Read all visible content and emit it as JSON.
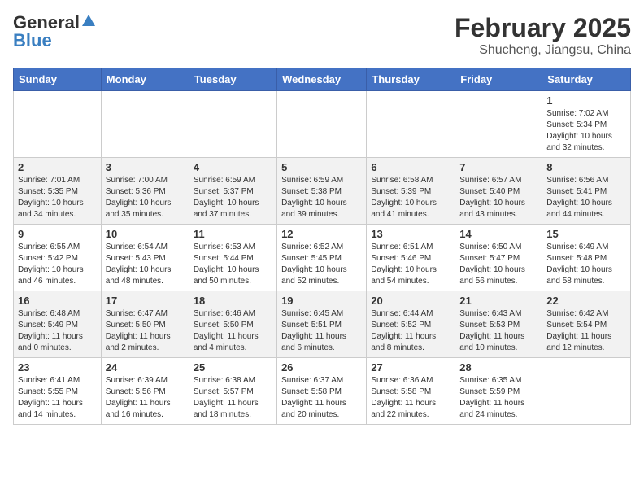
{
  "logo": {
    "general": "General",
    "blue": "Blue"
  },
  "title": {
    "month": "February 2025",
    "location": "Shucheng, Jiangsu, China"
  },
  "weekdays": [
    "Sunday",
    "Monday",
    "Tuesday",
    "Wednesday",
    "Thursday",
    "Friday",
    "Saturday"
  ],
  "weeks": [
    [
      {
        "day": "",
        "info": ""
      },
      {
        "day": "",
        "info": ""
      },
      {
        "day": "",
        "info": ""
      },
      {
        "day": "",
        "info": ""
      },
      {
        "day": "",
        "info": ""
      },
      {
        "day": "",
        "info": ""
      },
      {
        "day": "1",
        "info": "Sunrise: 7:02 AM\nSunset: 5:34 PM\nDaylight: 10 hours and 32 minutes."
      }
    ],
    [
      {
        "day": "2",
        "info": "Sunrise: 7:01 AM\nSunset: 5:35 PM\nDaylight: 10 hours and 34 minutes."
      },
      {
        "day": "3",
        "info": "Sunrise: 7:00 AM\nSunset: 5:36 PM\nDaylight: 10 hours and 35 minutes."
      },
      {
        "day": "4",
        "info": "Sunrise: 6:59 AM\nSunset: 5:37 PM\nDaylight: 10 hours and 37 minutes."
      },
      {
        "day": "5",
        "info": "Sunrise: 6:59 AM\nSunset: 5:38 PM\nDaylight: 10 hours and 39 minutes."
      },
      {
        "day": "6",
        "info": "Sunrise: 6:58 AM\nSunset: 5:39 PM\nDaylight: 10 hours and 41 minutes."
      },
      {
        "day": "7",
        "info": "Sunrise: 6:57 AM\nSunset: 5:40 PM\nDaylight: 10 hours and 43 minutes."
      },
      {
        "day": "8",
        "info": "Sunrise: 6:56 AM\nSunset: 5:41 PM\nDaylight: 10 hours and 44 minutes."
      }
    ],
    [
      {
        "day": "9",
        "info": "Sunrise: 6:55 AM\nSunset: 5:42 PM\nDaylight: 10 hours and 46 minutes."
      },
      {
        "day": "10",
        "info": "Sunrise: 6:54 AM\nSunset: 5:43 PM\nDaylight: 10 hours and 48 minutes."
      },
      {
        "day": "11",
        "info": "Sunrise: 6:53 AM\nSunset: 5:44 PM\nDaylight: 10 hours and 50 minutes."
      },
      {
        "day": "12",
        "info": "Sunrise: 6:52 AM\nSunset: 5:45 PM\nDaylight: 10 hours and 52 minutes."
      },
      {
        "day": "13",
        "info": "Sunrise: 6:51 AM\nSunset: 5:46 PM\nDaylight: 10 hours and 54 minutes."
      },
      {
        "day": "14",
        "info": "Sunrise: 6:50 AM\nSunset: 5:47 PM\nDaylight: 10 hours and 56 minutes."
      },
      {
        "day": "15",
        "info": "Sunrise: 6:49 AM\nSunset: 5:48 PM\nDaylight: 10 hours and 58 minutes."
      }
    ],
    [
      {
        "day": "16",
        "info": "Sunrise: 6:48 AM\nSunset: 5:49 PM\nDaylight: 11 hours and 0 minutes."
      },
      {
        "day": "17",
        "info": "Sunrise: 6:47 AM\nSunset: 5:50 PM\nDaylight: 11 hours and 2 minutes."
      },
      {
        "day": "18",
        "info": "Sunrise: 6:46 AM\nSunset: 5:50 PM\nDaylight: 11 hours and 4 minutes."
      },
      {
        "day": "19",
        "info": "Sunrise: 6:45 AM\nSunset: 5:51 PM\nDaylight: 11 hours and 6 minutes."
      },
      {
        "day": "20",
        "info": "Sunrise: 6:44 AM\nSunset: 5:52 PM\nDaylight: 11 hours and 8 minutes."
      },
      {
        "day": "21",
        "info": "Sunrise: 6:43 AM\nSunset: 5:53 PM\nDaylight: 11 hours and 10 minutes."
      },
      {
        "day": "22",
        "info": "Sunrise: 6:42 AM\nSunset: 5:54 PM\nDaylight: 11 hours and 12 minutes."
      }
    ],
    [
      {
        "day": "23",
        "info": "Sunrise: 6:41 AM\nSunset: 5:55 PM\nDaylight: 11 hours and 14 minutes."
      },
      {
        "day": "24",
        "info": "Sunrise: 6:39 AM\nSunset: 5:56 PM\nDaylight: 11 hours and 16 minutes."
      },
      {
        "day": "25",
        "info": "Sunrise: 6:38 AM\nSunset: 5:57 PM\nDaylight: 11 hours and 18 minutes."
      },
      {
        "day": "26",
        "info": "Sunrise: 6:37 AM\nSunset: 5:58 PM\nDaylight: 11 hours and 20 minutes."
      },
      {
        "day": "27",
        "info": "Sunrise: 6:36 AM\nSunset: 5:58 PM\nDaylight: 11 hours and 22 minutes."
      },
      {
        "day": "28",
        "info": "Sunrise: 6:35 AM\nSunset: 5:59 PM\nDaylight: 11 hours and 24 minutes."
      },
      {
        "day": "",
        "info": ""
      }
    ]
  ]
}
